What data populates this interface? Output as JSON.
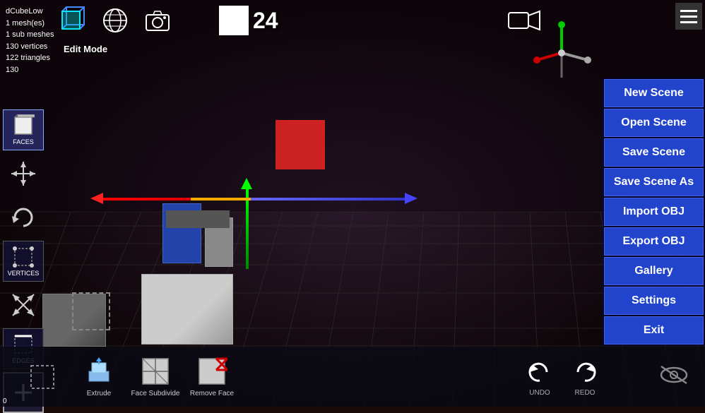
{
  "info": {
    "object_name": "dCubeLow",
    "meshes": "1 mesh(es)",
    "sub_meshes": "1 sub meshes",
    "vertices": "130 vertices",
    "triangles": "122 triangles",
    "extra": "130"
  },
  "mode": {
    "label": "Edit Mode"
  },
  "frame": {
    "number": "24"
  },
  "coordinate": {
    "value": "0"
  },
  "toolbar": {
    "faces_label": "FACES",
    "vertices_label": "VERTICES",
    "edges_label": "EDGES",
    "add_label": "+"
  },
  "menu": {
    "new_scene": "New Scene",
    "open_scene": "Open Scene",
    "save_scene": "Save Scene",
    "save_scene_as": "Save Scene As",
    "import_obj": "Import OBJ",
    "export_obj": "Export OBJ",
    "gallery": "Gallery",
    "settings": "Settings",
    "exit": "Exit"
  },
  "bottom_toolbar": {
    "extrude_label": "Extrude",
    "face_subdivide_label": "Face Subdivide",
    "remove_face_label": "Remove Face",
    "undo_label": "UNDO",
    "redo_label": "REDO"
  },
  "icons": {
    "globe": "🌐",
    "camera_photo": "📷",
    "video_camera": "🎥",
    "eye_closed": "👁",
    "hamburger": "☰"
  }
}
